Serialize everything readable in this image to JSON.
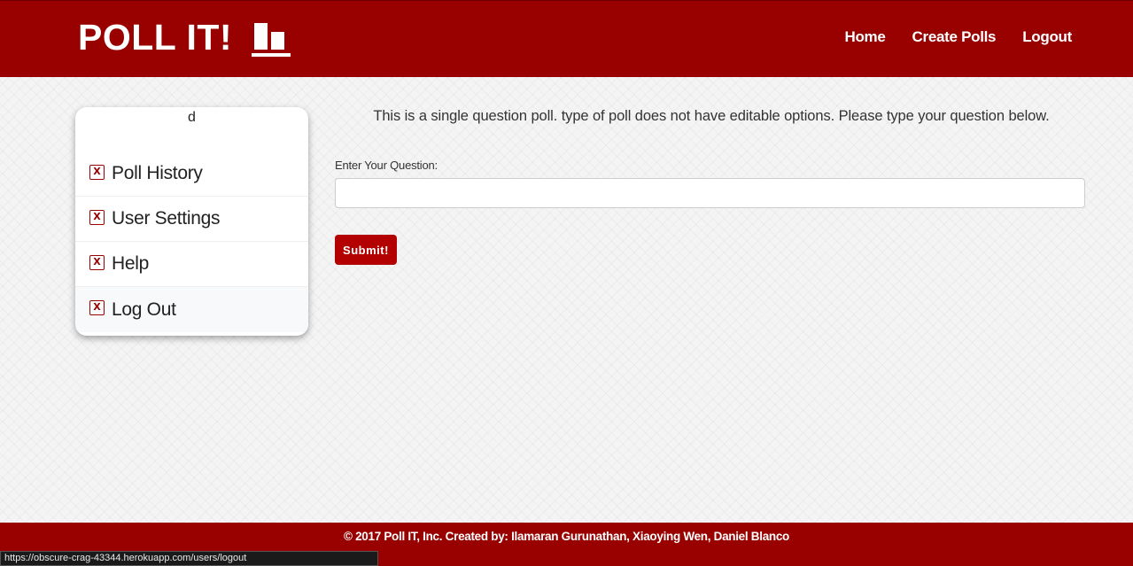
{
  "navbar": {
    "brand": "POLL IT!",
    "links": [
      "Home",
      "Create Polls",
      "Logout"
    ],
    "background": "#990000"
  },
  "sidebar": {
    "username": "d",
    "items": [
      {
        "icon": "close-icon",
        "label": "Poll History"
      },
      {
        "icon": "close-icon",
        "label": "User Settings"
      },
      {
        "icon": "close-icon",
        "label": "Help"
      },
      {
        "icon": "close-icon",
        "label": "Log Out"
      }
    ]
  },
  "main": {
    "intro": "This is a single question poll. type of poll does not have editable options. Please type your question below.",
    "question_label": "Enter Your Question:",
    "question_value": "",
    "submit_label": "Submit!",
    "accent": "#b30000"
  },
  "footer": {
    "text": "© 2017 Poll IT, Inc. Created by: Ilamaran Gurunathan, Xiaoying Wen, Daniel Blanco"
  },
  "status_bar": {
    "url": "https://obscure-crag-43344.herokuapp.com/users/logout"
  }
}
